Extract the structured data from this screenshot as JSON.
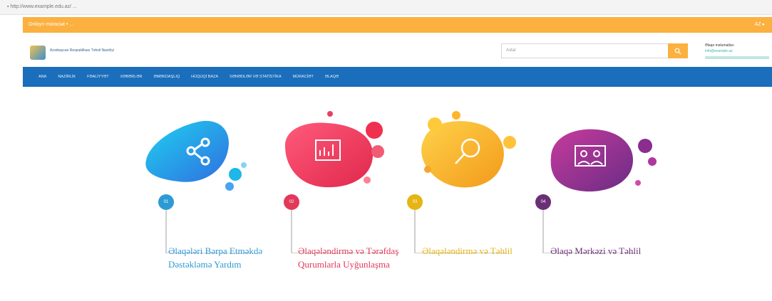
{
  "browser": {
    "url": "▪ http://www.example.edu.az/ ..."
  },
  "top_strip": {
    "left_text": "Onlayn müraciət • ...",
    "right_text": "AZ ▸"
  },
  "header": {
    "logo_text": "Azərbaycan Respublikası Təhsil Nazirliyi",
    "search_placeholder": "Axtar",
    "right_title": "Əlaqə məlumatları",
    "right_sub": "info@example.az"
  },
  "nav": {
    "items": [
      "ANA",
      "NAZİRLİK",
      "FƏALİYYƏT",
      "XƏBƏRLƏR",
      "ƏMƏKDAŞLIQ",
      "HÜQUQİ BAZA",
      "SƏNƏDLƏR VƏ STATİSTİKA",
      "MÜRACİƏT",
      "ƏLAQƏ"
    ]
  },
  "steps": [
    {
      "number": "01",
      "label": "Əlaqələri Bərpa Etməkdə Dəstəkləmə Yardım",
      "color": "#2e9ad4",
      "icon": "share-icon"
    },
    {
      "number": "02",
      "label": "Əlaqələndirmə və Tərəfdaş Qurumlarla Uyğunlaşma",
      "color": "#e2385a",
      "icon": "chart-icon"
    },
    {
      "number": "03",
      "label": "Əlaqələndirmə və Təhlil",
      "color": "#e6b413",
      "icon": "search-icon"
    },
    {
      "number": "04",
      "label": "Əlaqə Mərkəzi və Təhlil",
      "color": "#6b2f77",
      "icon": "people-icon"
    }
  ],
  "colors": {
    "nav_bg": "#1a6ebb",
    "accent": "#fbb040"
  }
}
